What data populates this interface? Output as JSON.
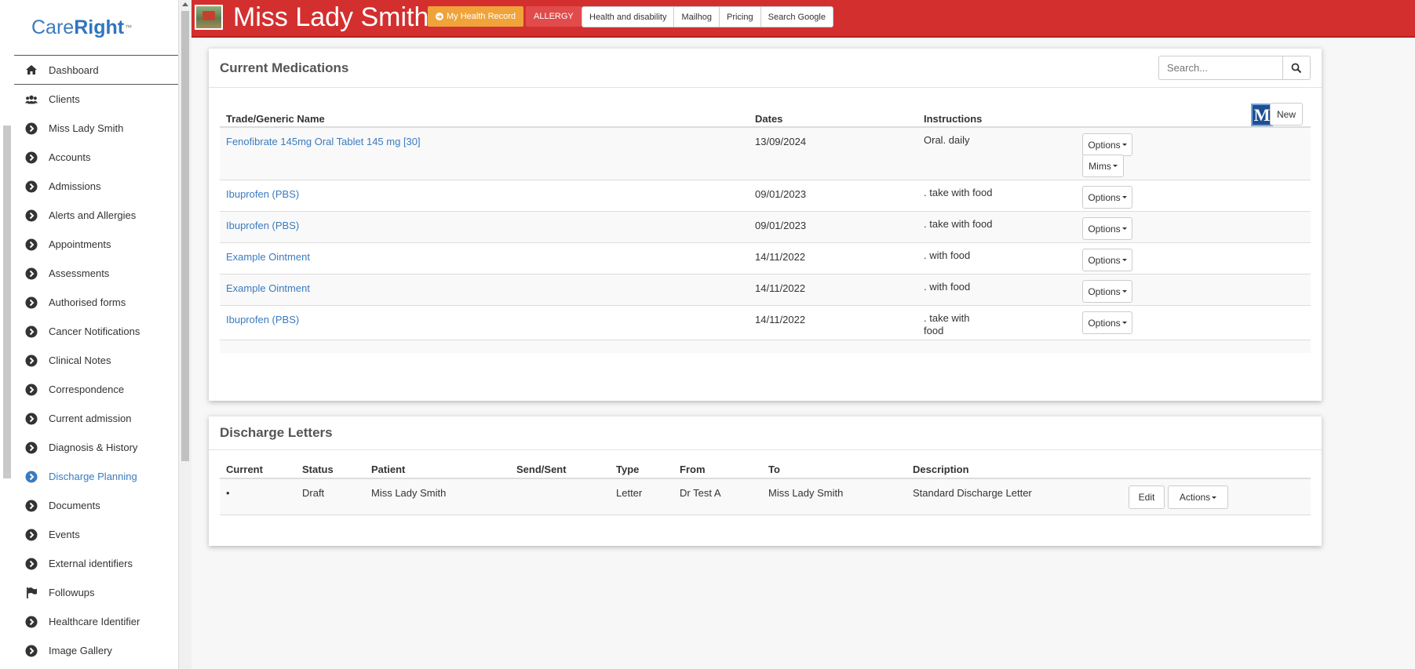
{
  "brand": {
    "name_a": "Care",
    "name_b": "Right",
    "tm": "™"
  },
  "sidebar": {
    "items": [
      {
        "label": "Dashboard",
        "icon": "home-icon"
      },
      {
        "label": "Clients",
        "icon": "users-icon"
      },
      {
        "label": "Miss Lady Smith",
        "icon": "chevron-circle-icon"
      },
      {
        "label": "Accounts",
        "icon": "chevron-circle-icon"
      },
      {
        "label": "Admissions",
        "icon": "chevron-circle-icon"
      },
      {
        "label": "Alerts and Allergies",
        "icon": "chevron-circle-icon"
      },
      {
        "label": "Appointments",
        "icon": "chevron-circle-icon"
      },
      {
        "label": "Assessments",
        "icon": "chevron-circle-icon"
      },
      {
        "label": "Authorised forms",
        "icon": "chevron-circle-icon"
      },
      {
        "label": "Cancer Notifications",
        "icon": "chevron-circle-icon"
      },
      {
        "label": "Clinical Notes",
        "icon": "chevron-circle-icon"
      },
      {
        "label": "Correspondence",
        "icon": "chevron-circle-icon"
      },
      {
        "label": "Current admission",
        "icon": "chevron-circle-icon"
      },
      {
        "label": "Diagnosis & History",
        "icon": "chevron-circle-icon"
      },
      {
        "label": "Discharge Planning",
        "icon": "chevron-circle-icon",
        "active": true
      },
      {
        "label": "Documents",
        "icon": "chevron-circle-icon"
      },
      {
        "label": "Events",
        "icon": "chevron-circle-icon"
      },
      {
        "label": "External identifiers",
        "icon": "chevron-circle-icon"
      },
      {
        "label": "Followups",
        "icon": "flag-icon"
      },
      {
        "label": "Healthcare Identifier",
        "icon": "chevron-circle-icon"
      },
      {
        "label": "Image Gallery",
        "icon": "chevron-circle-icon"
      }
    ]
  },
  "header": {
    "patient_name": "Miss Lady Smith",
    "my_health_record": "My Health Record",
    "allergy": "ALLERGY",
    "links": [
      "Health and disability",
      "Mailhog",
      "Pricing",
      "Search Google"
    ]
  },
  "colors": {
    "header_bg": "#d32f2f",
    "mhr_bg": "#f0a33a",
    "allergy_bg": "#e24b4b",
    "link": "#3a7bbf"
  },
  "medications": {
    "title": "Current Medications",
    "search_placeholder": "Search...",
    "columns": [
      "Trade/Generic Name",
      "Dates",
      "Instructions"
    ],
    "new_label": "New",
    "m_logo": "M",
    "options_label": "Options",
    "mims_label": "Mims",
    "rows": [
      {
        "name": "Fenofibrate 145mg Oral Tablet 145 mg [30]",
        "date": "13/09/2024",
        "instructions": "Oral. daily"
      },
      {
        "name": "Ibuprofen (PBS)",
        "date": "09/01/2023",
        "instructions": ". take with food"
      },
      {
        "name": "Ibuprofen (PBS)",
        "date": "09/01/2023",
        "instructions": ". take with food"
      },
      {
        "name": "Example Ointment",
        "date": "14/11/2022",
        "instructions": ". with food"
      },
      {
        "name": "Example Ointment",
        "date": "14/11/2022",
        "instructions": ". with food"
      },
      {
        "name": "Ibuprofen (PBS)",
        "date": "14/11/2022",
        "instructions": ". take with",
        "instructions_2": "food"
      }
    ]
  },
  "discharge": {
    "title": "Discharge Letters",
    "columns": [
      "Current",
      "Status",
      "Patient",
      "Send/Sent",
      "Type",
      "From",
      "To",
      "Description"
    ],
    "rows": [
      {
        "current": "•",
        "status": "Draft",
        "patient": "Miss Lady Smith",
        "send_sent": "",
        "type": "Letter",
        "from": "Dr Test A",
        "to": "Miss Lady Smith",
        "description": "Standard Discharge Letter"
      }
    ],
    "edit_label": "Edit",
    "actions_label": "Actions"
  }
}
